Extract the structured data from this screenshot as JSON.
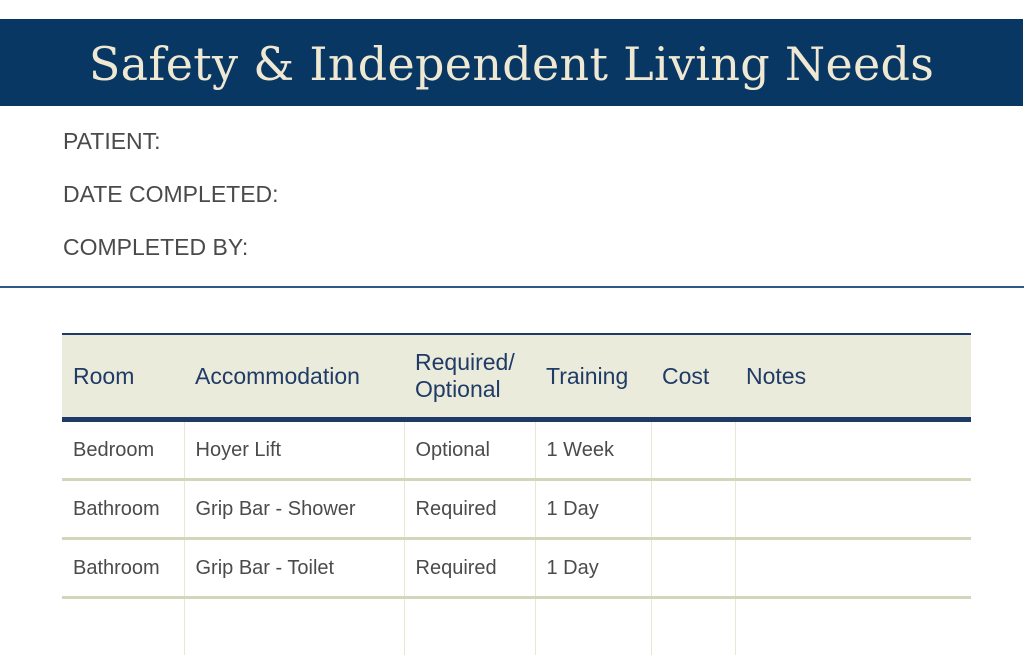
{
  "header": {
    "title": "Safety & Independent Living Needs"
  },
  "form_fields": [
    {
      "label": "PATIENT:",
      "value": ""
    },
    {
      "label": "DATE COMPLETED:",
      "value": ""
    },
    {
      "label": "COMPLETED BY:",
      "value": ""
    }
  ],
  "colors": {
    "banner": "#083763",
    "title_text": "#efe9d3",
    "table_header_bg": "#ebebdb",
    "table_header_text": "#1f3b66",
    "rule": "#1d3b66",
    "row_divider": "#d3d6b8"
  },
  "table": {
    "columns": [
      "Room",
      "Accommodation",
      "Required/ Optional",
      "Training",
      "Cost",
      "Notes"
    ],
    "column_lines": [
      [
        "Room"
      ],
      [
        "Accommodation"
      ],
      [
        "Required/",
        "Optional"
      ],
      [
        "Training"
      ],
      [
        "Cost"
      ],
      [
        "Notes"
      ]
    ],
    "rows": [
      [
        "Bedroom",
        "Hoyer Lift",
        "Optional",
        "1 Week",
        "",
        ""
      ],
      [
        "Bathroom",
        "Grip Bar - Shower",
        "Required",
        "1 Day",
        "",
        ""
      ],
      [
        "Bathroom",
        "Grip Bar - Toilet",
        "Required",
        "1 Day",
        "",
        ""
      ],
      [
        "",
        "",
        "",
        "",
        "",
        ""
      ]
    ]
  }
}
